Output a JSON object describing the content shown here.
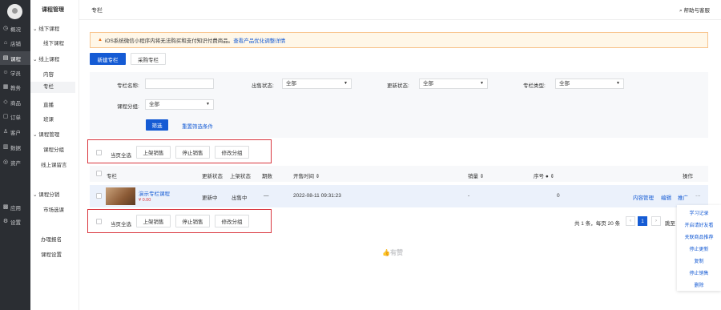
{
  "rail": {
    "items": [
      {
        "label": "概况",
        "icon": "dashboard-icon",
        "glyph": "◷"
      },
      {
        "label": "店铺",
        "icon": "store-icon",
        "glyph": "⌂"
      },
      {
        "label": "课程",
        "icon": "course-icon",
        "glyph": "▤"
      },
      {
        "label": "学员",
        "icon": "student-icon",
        "glyph": "☺"
      },
      {
        "label": "教务",
        "icon": "teaching-icon",
        "glyph": "▦"
      },
      {
        "label": "商品",
        "icon": "product-icon",
        "glyph": "◇"
      },
      {
        "label": "订单",
        "icon": "order-icon",
        "glyph": "▢"
      },
      {
        "label": "客户",
        "icon": "customer-icon",
        "glyph": "♙"
      },
      {
        "label": "数据",
        "icon": "data-icon",
        "glyph": "▥"
      },
      {
        "label": "资产",
        "icon": "asset-icon",
        "glyph": "◎"
      },
      {
        "label": "应用",
        "icon": "apps-icon",
        "glyph": "▩"
      },
      {
        "label": "设置",
        "icon": "settings-icon",
        "glyph": "⚙"
      }
    ]
  },
  "subnav": {
    "title": "课程管理",
    "offline_head": "线下课程",
    "offline_course": "线下课程",
    "online_head": "线上课程",
    "content": "内容",
    "column": "专栏",
    "live": "直播",
    "class": "班课",
    "course_mgmt": "课程管理",
    "course_group": "课程分组",
    "online_comment": "线上课留言",
    "distribution": "课程分销",
    "market": "市场选课",
    "registration": "办理报名",
    "settings": "课程设置"
  },
  "topbar": {
    "breadcrumb": "专栏",
    "help": "帮助与客服"
  },
  "notice": {
    "text": "iOS系统微信小程序内将无法购买和支付知识付费商品。",
    "link": "查看产品优化调整详情"
  },
  "actions": {
    "new_column": "新建专栏",
    "purchase_column": "采购专栏"
  },
  "filters": {
    "name_label": "专栏名称:",
    "sale_status_label": "出售状态:",
    "sale_status_value": "全部",
    "update_status_label": "更新状态:",
    "update_status_value": "全部",
    "column_type_label": "专栏类型:",
    "column_type_value": "全部",
    "group_label": "课程分组:",
    "group_value": "全部",
    "filter_button": "筛选",
    "reset_link": "重置筛选条件"
  },
  "bulk": {
    "select_page": "当页全选",
    "on_sale": "上架销售",
    "stop_sale": "停止销售",
    "change_group": "修改分组"
  },
  "table": {
    "headers": {
      "column": "专栏",
      "update_status": "更新状态",
      "listing_status": "上架状态",
      "issues": "期数",
      "sale_time": "开售时间 ⇕",
      "sales": "销量 ⇕",
      "order": "序号",
      "actions": "操作"
    },
    "row": {
      "title": "演示专栏课程",
      "price": "¥ 0.00",
      "update_status": "更新中",
      "listing_status": "出售中",
      "issues": "—",
      "sale_time": "2022-08-11 09:31:23",
      "sales": "-",
      "order": "0",
      "action_manage": "内容管理",
      "action_edit": "编辑",
      "action_promote": "推广",
      "action_more": "···"
    }
  },
  "pager": {
    "summary": "共 1 条，每页 20 条",
    "current": "1",
    "jump": "跳至"
  },
  "empty": {
    "text": "有赞"
  },
  "dropdown": {
    "items": [
      "学习记录",
      "开启请好友看",
      "关联商品推荐",
      "停止更新",
      "复制",
      "停止销售",
      "删除"
    ]
  },
  "colors": {
    "primary": "#155bd4",
    "highlight": "#d9363e",
    "notice_bg": "#fff7e8",
    "rail_bg": "#2b2e33"
  }
}
